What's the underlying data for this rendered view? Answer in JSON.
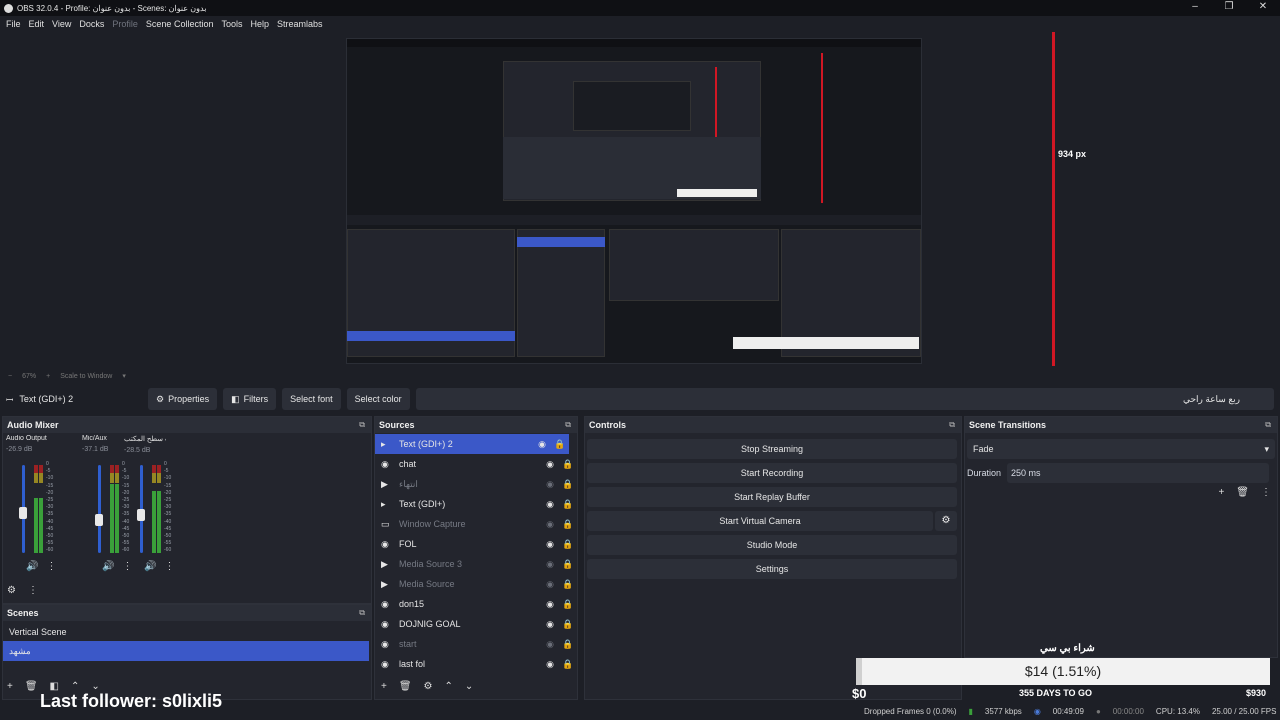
{
  "window": {
    "title": "OBS 32.0.4 - Profile: بدون عنوان - Scenes: بدون عنوان",
    "controls": [
      "–",
      "❐",
      "✕"
    ]
  },
  "menu": [
    "File",
    "Edit",
    "View",
    "Docks",
    "Profile",
    "Scene Collection",
    "Tools",
    "Help",
    "Streamlabs"
  ],
  "preview": {
    "px_label": "934 px",
    "zoom": "67%",
    "scale_mode": "Scale to Window"
  },
  "source_toolbar": {
    "selected_source": "Text (GDI+) 2",
    "properties": "Properties",
    "filters": "Filters",
    "select_font": "Select font",
    "select_color": "Select color",
    "text_value": "ربع ساعة راحي"
  },
  "audio_mixer": {
    "title": "Audio Mixer",
    "channels": [
      {
        "name": "Audio Output Capt",
        "db": "-26.9 dB",
        "level": 0.62,
        "volume": 0.45
      },
      {
        "name": "Mic/Aux",
        "db": "-37.1 dB",
        "level": 0.78,
        "volume": 0.35
      },
      {
        "name": "صوت سطح المكتب",
        "db": "-28.5 dB",
        "level": 0.7,
        "volume": 0.42
      }
    ],
    "scale": [
      "0",
      "-5",
      "-10",
      "-15",
      "-20",
      "-25",
      "-30",
      "-35",
      "-40",
      "-45",
      "-50",
      "-55",
      "-60"
    ]
  },
  "scenes": {
    "title": "Scenes",
    "items": [
      {
        "name": "Vertical Scene",
        "selected": false
      },
      {
        "name": "مشهد",
        "selected": true
      }
    ]
  },
  "sources": {
    "title": "Sources",
    "items": [
      {
        "name": "Text (GDI+) 2",
        "icon": "text-icon",
        "visible": true,
        "locked": false,
        "selected": true
      },
      {
        "name": "chat",
        "icon": "browser-icon",
        "visible": true,
        "locked": true,
        "selected": false
      },
      {
        "name": "انتهاء",
        "icon": "media-icon",
        "visible": false,
        "locked": false,
        "selected": false
      },
      {
        "name": "Text (GDI+)",
        "icon": "text-icon",
        "visible": true,
        "locked": true,
        "selected": false
      },
      {
        "name": "Window Capture",
        "icon": "window-icon",
        "visible": false,
        "locked": true,
        "selected": false
      },
      {
        "name": "FOL",
        "icon": "browser-icon",
        "visible": true,
        "locked": true,
        "selected": false
      },
      {
        "name": "Media Source 3",
        "icon": "media-icon",
        "visible": false,
        "locked": true,
        "selected": false
      },
      {
        "name": "Media Source",
        "icon": "media-icon",
        "visible": false,
        "locked": true,
        "selected": false
      },
      {
        "name": "don15",
        "icon": "browser-icon",
        "visible": true,
        "locked": true,
        "selected": false
      },
      {
        "name": "DOJNIG GOAL",
        "icon": "browser-icon",
        "visible": true,
        "locked": true,
        "selected": false
      },
      {
        "name": "start",
        "icon": "browser-icon",
        "visible": false,
        "locked": false,
        "selected": false
      },
      {
        "name": "last fol",
        "icon": "browser-icon",
        "visible": true,
        "locked": true,
        "selected": false
      }
    ]
  },
  "controls": {
    "title": "Controls",
    "buttons": [
      "Stop Streaming",
      "Start Recording",
      "Start Replay Buffer",
      "Start Virtual Camera",
      "Studio Mode",
      "Settings"
    ]
  },
  "transitions": {
    "title": "Scene Transitions",
    "selected": "Fade",
    "duration_label": "Duration",
    "duration_value": "250 ms"
  },
  "overlay": {
    "goal_title": "شراء بي سي",
    "goal_amount": "$14 (1.51%)",
    "goal_progress": 0.0151,
    "goal_start": "$0",
    "goal_end": "$930",
    "days_left": "355 DAYS TO GO",
    "last_follower": "Last follower: s0lixli5"
  },
  "status": {
    "dropped": "Dropped Frames 0 (0.0%)",
    "bitrate": "3577 kbps",
    "stream_time": "00:49:09",
    "rec_time": "00:00:00",
    "cpu": "CPU: 13.4%",
    "fps": "25.00 / 25.00 FPS"
  },
  "colors": {
    "accent": "#3b58c8",
    "background": "#1d1f26",
    "dock": "#23252d",
    "meter_green": "#3aa03a",
    "meter_yellow": "#c8b020",
    "meter_red": "#d02020",
    "redline": "#d01724"
  }
}
